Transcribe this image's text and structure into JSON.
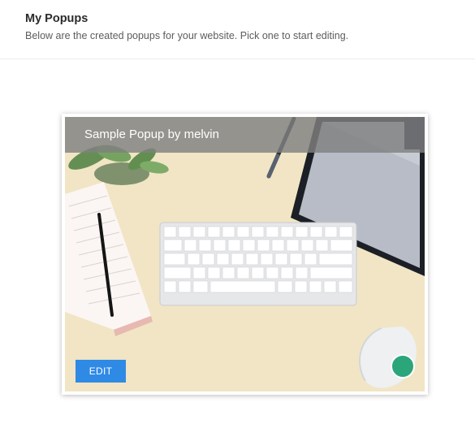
{
  "header": {
    "title": "My Popups",
    "subtitle": "Below are the created popups for your website. Pick one to start editing."
  },
  "popups": [
    {
      "title": "Sample Popup by melvin",
      "edit_label": "EDIT",
      "status_color": "#2aa67a",
      "image": "desk-workspace-photo"
    }
  ],
  "colors": {
    "edit_button": "#2f8ae6",
    "title_overlay": "#808080"
  }
}
